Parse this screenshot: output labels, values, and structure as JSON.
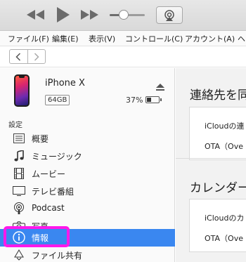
{
  "toolbar": {
    "controls": [
      "rewind-icon",
      "play-icon",
      "fast-forward-icon",
      "volume-slider",
      "airplay-icon"
    ],
    "volume_level": 0.4
  },
  "menubar": {
    "items": [
      "ファイル(F)",
      "編集(E)",
      "表示(V)",
      "コントロール(C)",
      "アカウント(A)",
      "ヘ"
    ]
  },
  "nav": {
    "back_icon": "chevron-left-icon",
    "forward_icon": "chevron-right-icon"
  },
  "device": {
    "name": "iPhone X",
    "capacity": "64GB",
    "battery_pct": "37%",
    "battery_level": 0.37
  },
  "sidebar": {
    "section_label": "設定",
    "items": [
      {
        "label": "概要",
        "icon": "summary-list-icon"
      },
      {
        "label": "ミュージック",
        "icon": "music-note-icon"
      },
      {
        "label": "ムービー",
        "icon": "film-icon"
      },
      {
        "label": "テレビ番組",
        "icon": "tv-icon"
      },
      {
        "label": "Podcast",
        "icon": "podcast-icon"
      },
      {
        "label": "写真",
        "icon": "camera-icon"
      },
      {
        "label": "情報",
        "icon": "info-icon",
        "selected": true
      },
      {
        "label": "ファイル共有",
        "icon": "file-sharing-icon"
      }
    ],
    "selected_color": "#3a87f0",
    "highlight_color": "#ff19ea"
  },
  "main": {
    "sections": [
      {
        "heading": "連絡先を同",
        "lines": [
          "iCloudの連",
          "OTA（Ove"
        ]
      },
      {
        "heading": "カレンダーを",
        "lines": [
          "iCloudのカ",
          "OTA（Ove"
        ]
      }
    ]
  }
}
